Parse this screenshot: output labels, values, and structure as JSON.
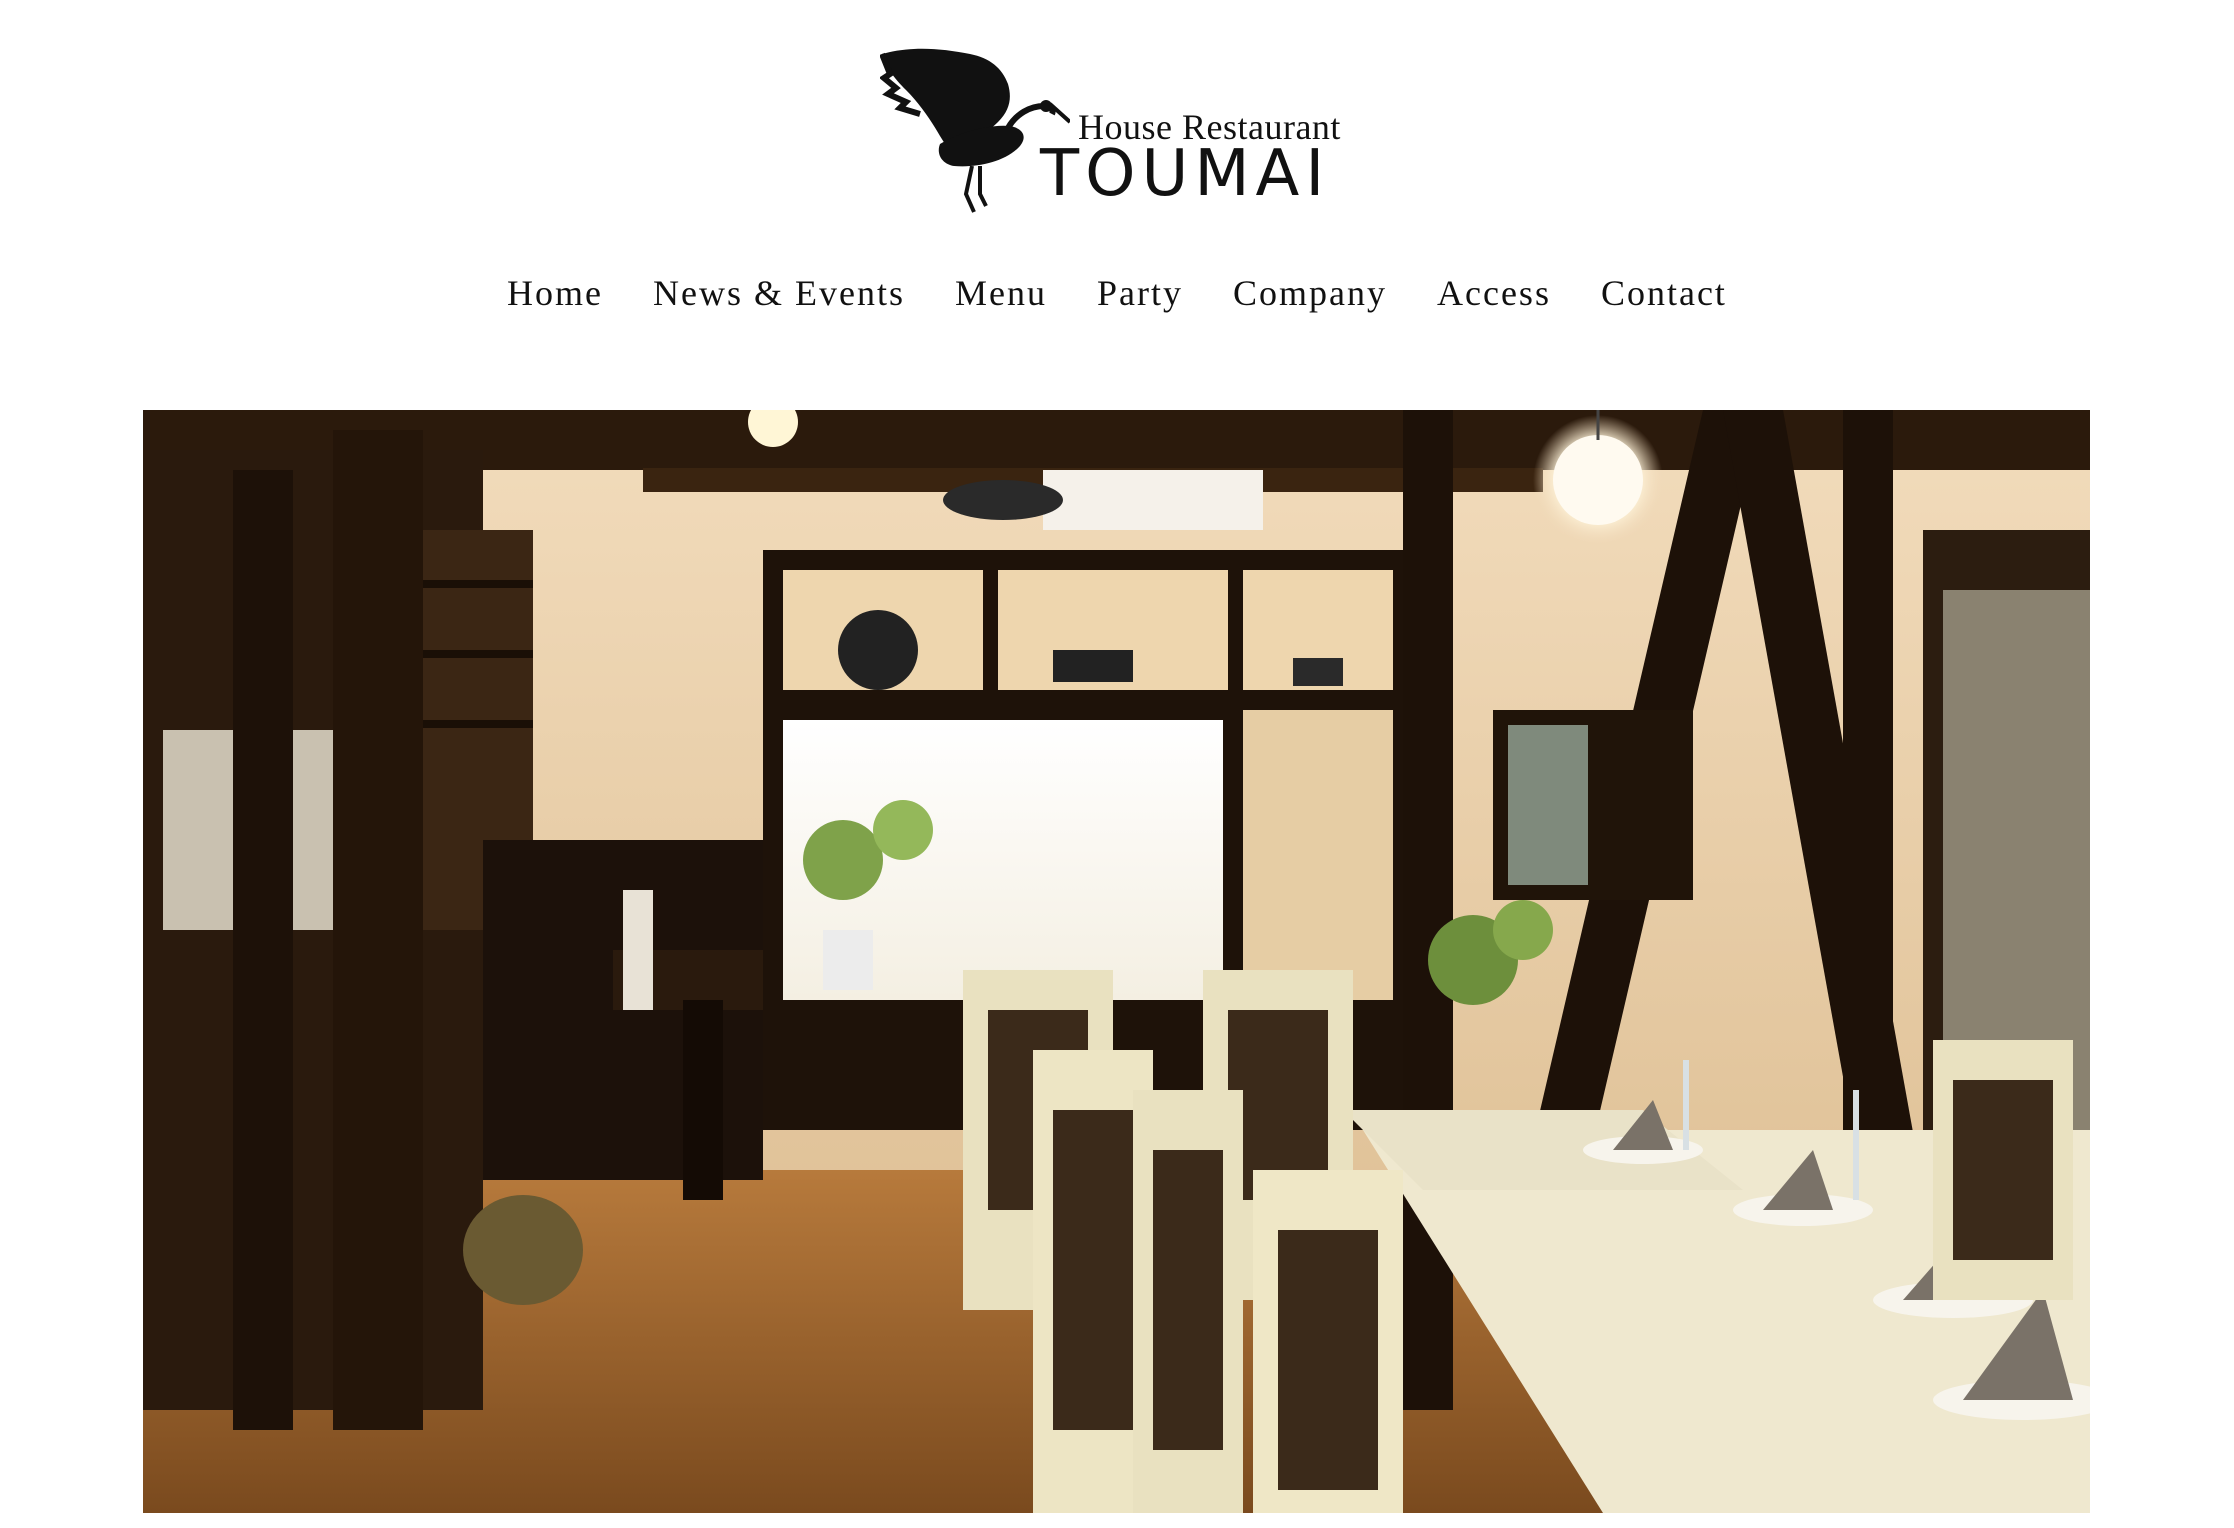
{
  "logo": {
    "icon": "crane-bird-icon",
    "subtitle": "House Restaurant",
    "name": "TOUMAI"
  },
  "nav": {
    "items": [
      {
        "label": "Home"
      },
      {
        "label": "News & Events"
      },
      {
        "label": "Menu"
      },
      {
        "label": "Party"
      },
      {
        "label": "Company"
      },
      {
        "label": "Access"
      },
      {
        "label": "Contact"
      }
    ]
  },
  "hero": {
    "image": "restaurant-interior-photo"
  }
}
